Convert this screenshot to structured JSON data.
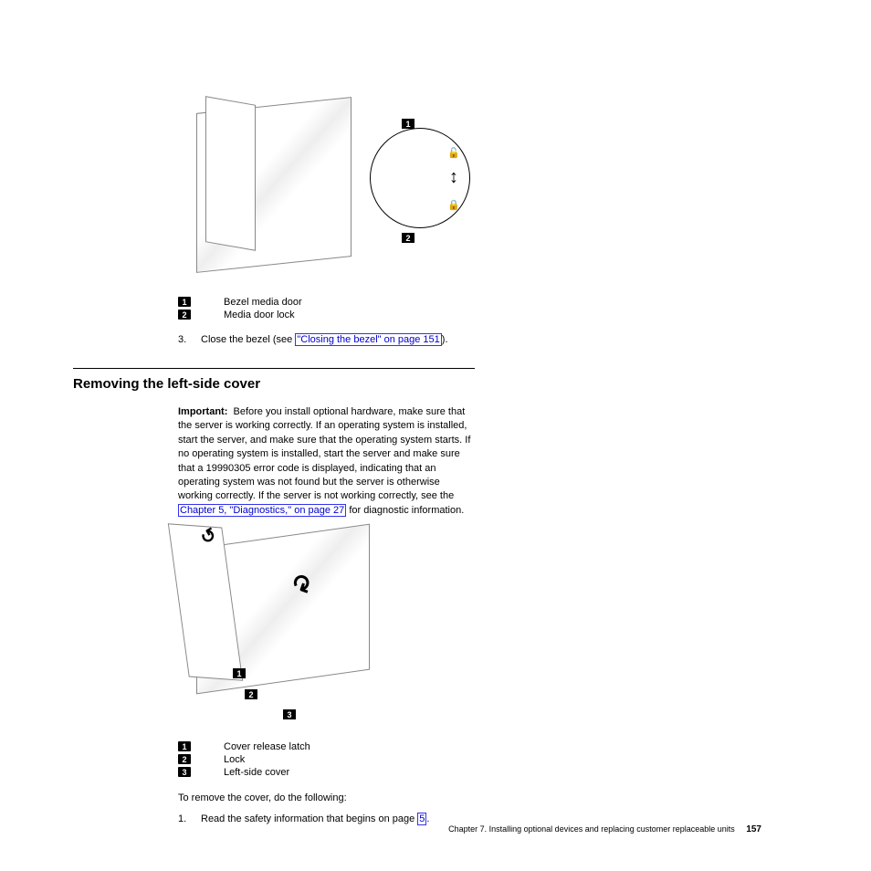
{
  "figure1": {
    "callouts": [
      {
        "num": "1",
        "label": "Bezel media door"
      },
      {
        "num": "2",
        "label": "Media door lock"
      }
    ]
  },
  "step_after_fig1": {
    "num": "3.",
    "text_before": "Close the bezel (see ",
    "link": "\"Closing the bezel\" on page 151",
    "text_after": ")."
  },
  "section": {
    "heading": "Removing the left-side cover",
    "important_label": "Important:",
    "important_text_before": "Before you install optional hardware, make sure that the server is working correctly. If an operating system is installed, start the server, and make sure that the operating system starts. If no operating system is installed, start the server and make sure that a 19990305 error code is displayed, indicating that an operating system was not found but the server is otherwise working correctly. If the server is not working correctly, see the ",
    "important_link": "Chapter 5, \"Diagnostics,\" on page 27",
    "important_text_after": " for diagnostic information."
  },
  "figure2": {
    "callouts": [
      {
        "num": "1",
        "label": "Cover release latch"
      },
      {
        "num": "2",
        "label": "Lock"
      },
      {
        "num": "3",
        "label": "Left-side cover"
      }
    ]
  },
  "intro_step": "To remove the cover, do the following:",
  "step1": {
    "num": "1.",
    "text_before": "Read the safety information that begins on page ",
    "link": "5",
    "text_after": "."
  },
  "footer": {
    "chapter": "Chapter 7. Installing optional devices and replacing customer replaceable units",
    "page": "157"
  }
}
